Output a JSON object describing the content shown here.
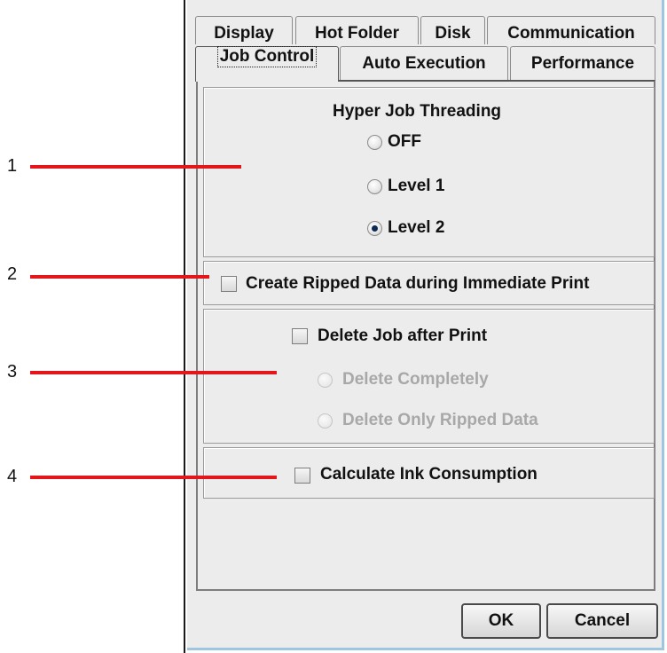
{
  "tabs_row1": [
    "Display",
    "Hot Folder",
    "Disk",
    "Communication"
  ],
  "tabs_row2": [
    "Job Control",
    "Auto Execution",
    "Performance"
  ],
  "active_tab": "Job Control",
  "hyper_job_threading": {
    "title": "Hyper Job Threading",
    "options": [
      "OFF",
      "Level 1",
      "Level 2"
    ],
    "selected": "Level 2"
  },
  "create_ripped_data": {
    "label": "Create Ripped Data during Immediate Print",
    "checked": false
  },
  "delete_job": {
    "label": "Delete Job after Print",
    "checked": false,
    "options": [
      "Delete Completely",
      "Delete Only Ripped Data"
    ],
    "options_enabled": false
  },
  "calculate_ink": {
    "label": "Calculate Ink Consumption",
    "checked": false
  },
  "buttons": {
    "ok": "OK",
    "cancel": "Cancel"
  },
  "callouts": [
    "1",
    "2",
    "3",
    "4"
  ],
  "colors": {
    "callout_line": "#e3161c",
    "dialog_background": "#ececec",
    "dialog_border": "#9ec6e0"
  }
}
